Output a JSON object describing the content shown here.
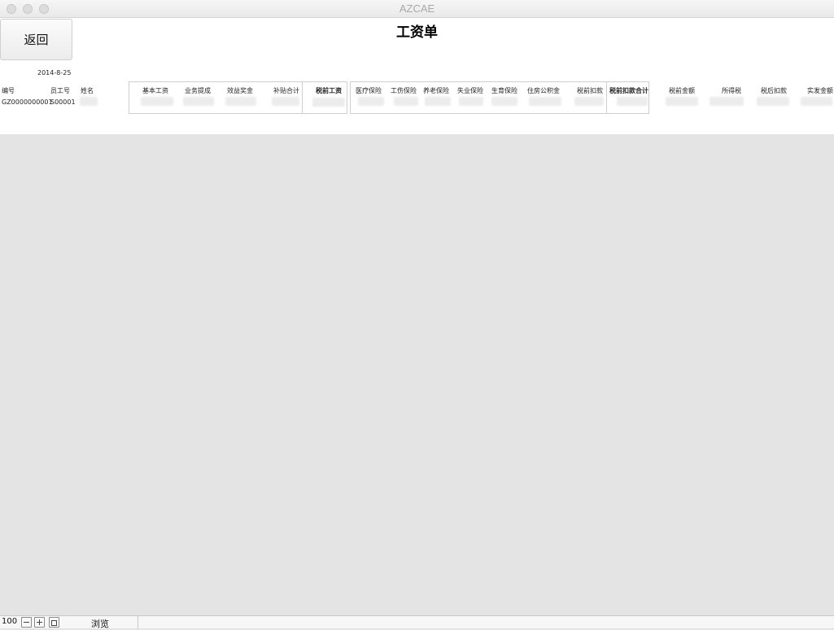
{
  "window": {
    "title": "AZCAE"
  },
  "header": {
    "back_label": "返回",
    "title": "工资单",
    "date": "2014-8-25"
  },
  "record_fields": {
    "id_label": "编号",
    "id_value": "GZ0000000001",
    "emp_label": "员工号",
    "emp_value": "S00001",
    "name_label": "姓名"
  },
  "income": {
    "base_label": "基本工资",
    "commission_label": "业务提成",
    "bonus_label": "效益奖金",
    "subsidy_label": "补贴合计",
    "pretax_label": "税前工资"
  },
  "deductions": {
    "medical_label": "医疗保险",
    "injury_label": "工伤保险",
    "pension_label": "养老保险",
    "unemployment_label": "失业保险",
    "maternity_label": "生育保险",
    "housing_label": "住房公积金",
    "pretax_deduct_label": "税前扣款",
    "pretax_deduct_total_label": "税前扣款合计"
  },
  "net": {
    "pretax_amount_label": "税前金额",
    "income_tax_label": "所得税",
    "posttax_deduct_label": "税后扣款",
    "net_pay_label": "实发金额"
  },
  "statusbar": {
    "zoom": "100",
    "mode": "浏览"
  }
}
